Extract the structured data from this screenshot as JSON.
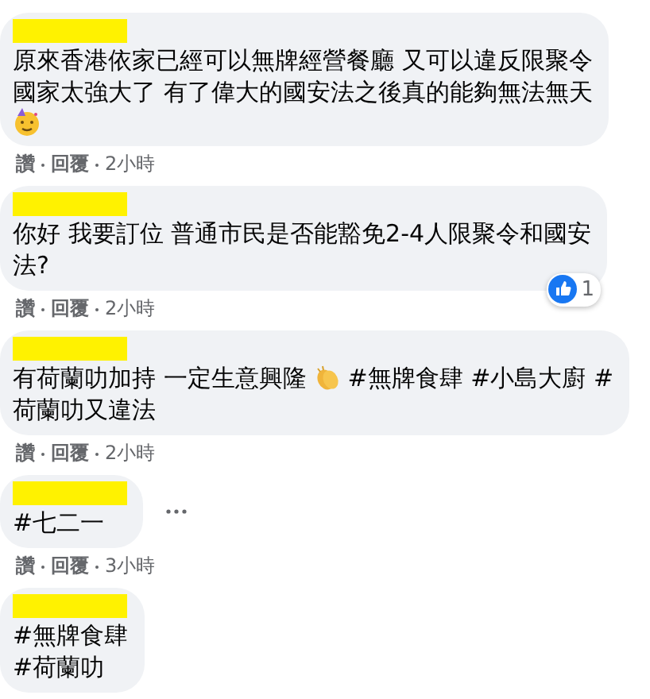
{
  "comments": [
    {
      "name_redacted": true,
      "lines": [
        [
          {
            "kind": "text",
            "text": "原來香港依家已經可以無牌經營餐廳 又可以違反限聚令"
          }
        ],
        [
          {
            "kind": "text",
            "text": "國家太強大了 有了偉大的國安法之後真的能夠無法無天"
          }
        ],
        [
          {
            "kind": "party"
          }
        ]
      ],
      "actions": [
        "讚",
        "回覆"
      ],
      "time": "2小時",
      "more": false
    },
    {
      "name_redacted": true,
      "lines": [
        [
          {
            "kind": "text",
            "text": "你好 我要訂位 普通市民是否能豁免2-4人限聚令和國安"
          }
        ],
        [
          {
            "kind": "text",
            "text": "法?"
          }
        ]
      ],
      "actions": [
        "讚",
        "回覆"
      ],
      "time": "2小時",
      "reaction_count": "1",
      "more": false
    },
    {
      "name_redacted": true,
      "lines": [
        [
          {
            "kind": "text",
            "text": "有荷蘭叻加持 一定生意興隆"
          },
          {
            "kind": "clap"
          },
          {
            "kind": "text",
            "text": "#無牌食肆 #小島大廚 #"
          }
        ],
        [
          {
            "kind": "text",
            "text": "荷蘭叻又違法"
          }
        ]
      ],
      "actions": [
        "讚",
        "回覆"
      ],
      "time": "2小時",
      "more": false
    },
    {
      "name_redacted": true,
      "lines": [
        [
          {
            "kind": "text",
            "text": "#七二一"
          }
        ]
      ],
      "actions": [
        "讚",
        "回覆"
      ],
      "time": "3小時",
      "more": true
    },
    {
      "name_redacted": true,
      "lines": [
        [
          {
            "kind": "text",
            "text": "#無牌食肆"
          }
        ],
        [
          {
            "kind": "text",
            "text": "#荷蘭叻"
          }
        ]
      ],
      "more": false
    }
  ]
}
